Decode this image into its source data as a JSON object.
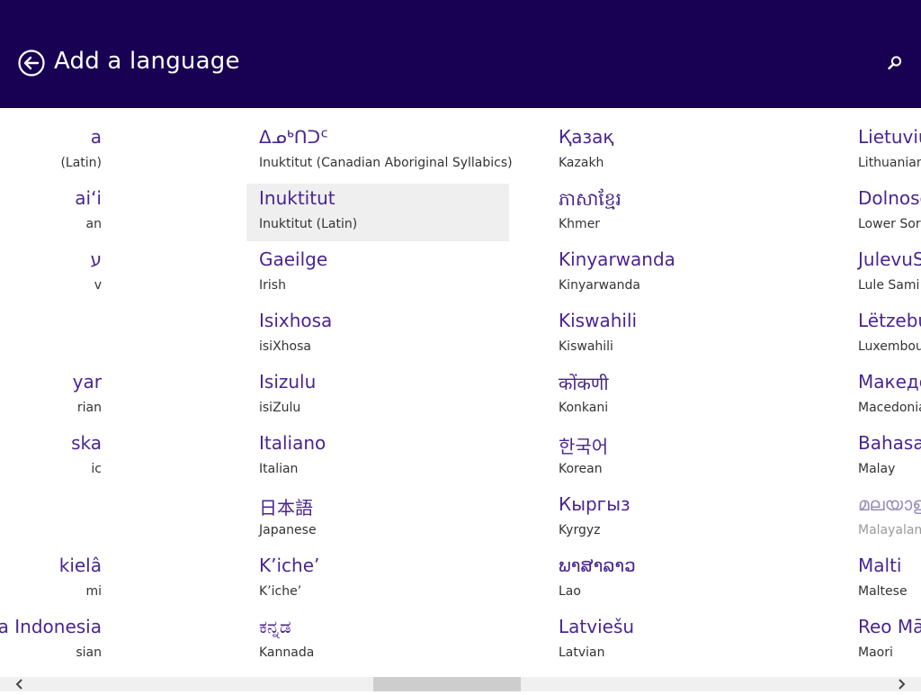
{
  "header": {
    "title": "Add a language",
    "back_icon": "back-arrow-circle-icon",
    "search_icon": "search-icon"
  },
  "colors": {
    "header_bg": "#180052",
    "native_text": "#4a2591",
    "selected_tile_bg": "#efefef"
  },
  "columns": [
    {
      "items": [
        {
          "native": "a",
          "english": "(Latin)"
        },
        {
          "native": "ai‘i",
          "english": "an"
        },
        {
          "native": "ע",
          "english": "v"
        },
        {
          "native": "",
          "english": ""
        },
        {
          "native": "yar",
          "english": "rian"
        },
        {
          "native": "ska",
          "english": "ic"
        },
        {
          "native": "",
          "english": ""
        },
        {
          "native": "kielâ",
          "english": "mi"
        },
        {
          "native": "sa Indonesia",
          "english": "sian"
        }
      ]
    },
    {
      "items": [
        {
          "native": "ᐃᓄᒃᑎᑐᑦ",
          "english": "Inuktitut (Canadian Aboriginal Syllabics)"
        },
        {
          "native": "Inuktitut",
          "english": "Inuktitut (Latin)",
          "selected": true
        },
        {
          "native": "Gaeilge",
          "english": "Irish"
        },
        {
          "native": "Isixhosa",
          "english": "isiXhosa"
        },
        {
          "native": "Isizulu",
          "english": "isiZulu"
        },
        {
          "native": "Italiano",
          "english": "Italian"
        },
        {
          "native": "日本語",
          "english": "Japanese"
        },
        {
          "native": "K’iche’",
          "english": "K’iche’"
        },
        {
          "native": "ಕನ್ನಡ",
          "english": "Kannada"
        }
      ]
    },
    {
      "items": [
        {
          "native": "Қазақ",
          "english": "Kazakh"
        },
        {
          "native": "ភាសាខ្មែរ",
          "english": "Khmer"
        },
        {
          "native": "Kinyarwanda",
          "english": "Kinyarwanda"
        },
        {
          "native": "Kiswahili",
          "english": "Kiswahili"
        },
        {
          "native": "कोंकणी",
          "english": "Konkani"
        },
        {
          "native": "한국어",
          "english": "Korean"
        },
        {
          "native": "Кыргыз",
          "english": "Kyrgyz"
        },
        {
          "native": "ພາສາລາວ",
          "english": "Lao"
        },
        {
          "native": "Latviešu",
          "english": "Latvian"
        }
      ]
    },
    {
      "items": [
        {
          "native": "Lietuvių",
          "english": "Lithuanian"
        },
        {
          "native": "Dolnoserbšćina",
          "english": "Lower Sorbian"
        },
        {
          "native": "JulevuSámegiella",
          "english": "Lule Sami"
        },
        {
          "native": "Lëtzebuergesch",
          "english": "Luxembourgish"
        },
        {
          "native": "Македонски",
          "english": "Macedonian"
        },
        {
          "native": "Bahasa Melayu",
          "english": "Malay"
        },
        {
          "native": "മലയാളം",
          "english": "Malayalam",
          "disabled": true
        },
        {
          "native": "Malti",
          "english": "Maltese"
        },
        {
          "native": "Reo Māori",
          "english": "Maori"
        }
      ]
    }
  ],
  "scrollbar": {
    "left_icon": "chevron-left-icon",
    "right_icon": "chevron-right-icon",
    "position": 0.4
  }
}
